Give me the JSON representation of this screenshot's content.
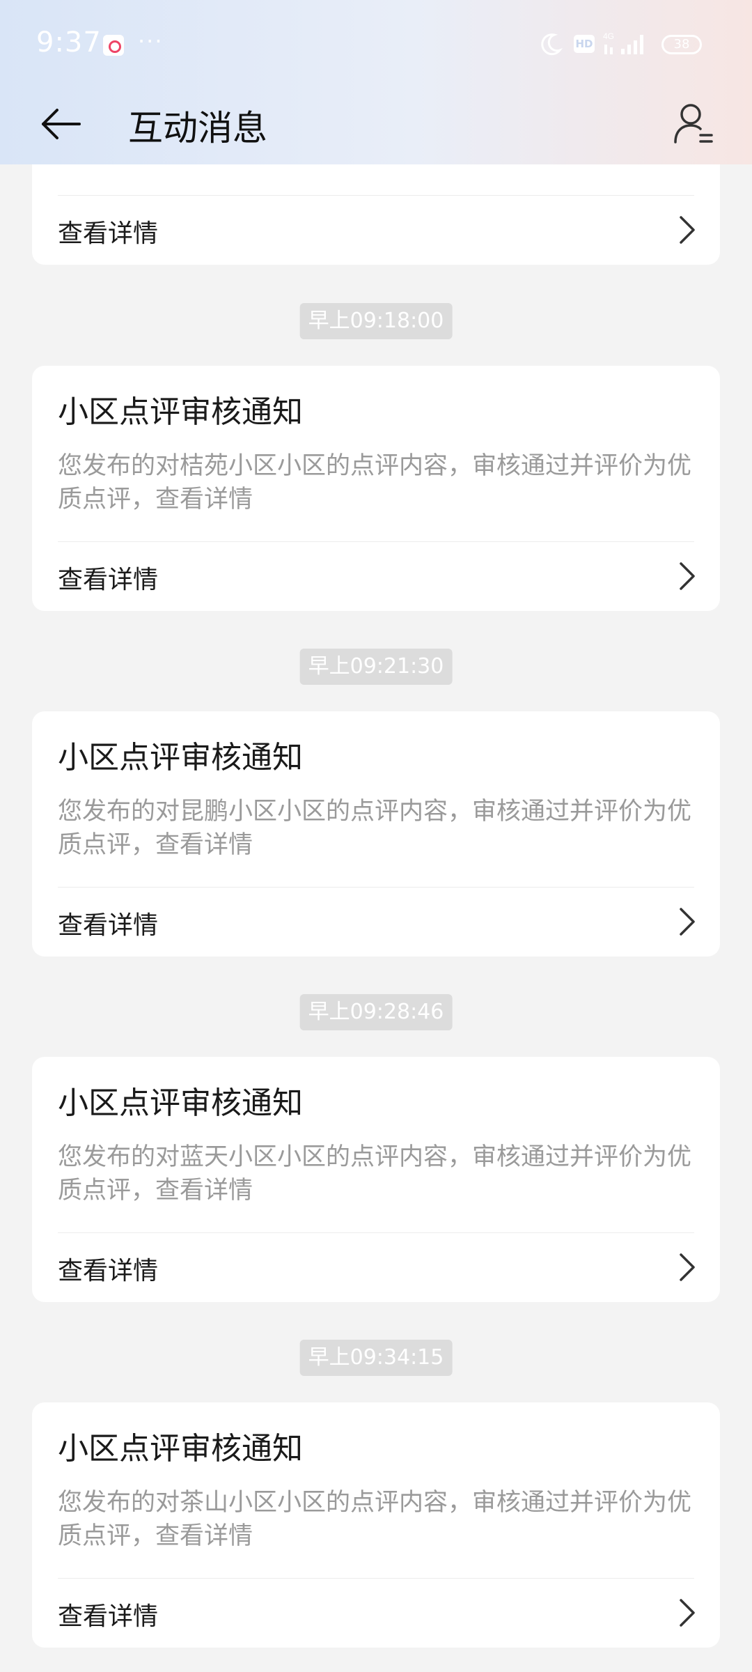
{
  "status_bar": {
    "time": "9:37",
    "dots": "···",
    "hd": "HD",
    "battery": "38"
  },
  "nav": {
    "title": "互动消息"
  },
  "partial_card": {
    "action_label": "查看详情"
  },
  "messages": [
    {
      "timestamp": "早上09:18:00",
      "title": "小区点评审核通知",
      "body": "您发布的对桔苑小区小区的点评内容，审核通过并评价为优质点评，查看详情",
      "action_label": "查看详情"
    },
    {
      "timestamp": "早上09:21:30",
      "title": "小区点评审核通知",
      "body": "您发布的对昆鹏小区小区的点评内容，审核通过并评价为优质点评，查看详情",
      "action_label": "查看详情"
    },
    {
      "timestamp": "早上09:28:46",
      "title": "小区点评审核通知",
      "body": "您发布的对蓝天小区小区的点评内容，审核通过并评价为优质点评，查看详情",
      "action_label": "查看详情"
    },
    {
      "timestamp": "早上09:34:15",
      "title": "小区点评审核通知",
      "body": "您发布的对茶山小区小区的点评内容，审核通过并评价为优质点评，查看详情",
      "action_label": "查看详情"
    }
  ],
  "colors": {
    "background": "#f3f3f3",
    "card": "#ffffff",
    "title_text": "#1a1a1a",
    "body_text": "#9a9a9a",
    "timestamp_bg": "#dcdcdc"
  },
  "icons": {
    "back": "arrow-left-icon",
    "profile": "user-list-icon",
    "chevron": "chevron-right-icon"
  }
}
